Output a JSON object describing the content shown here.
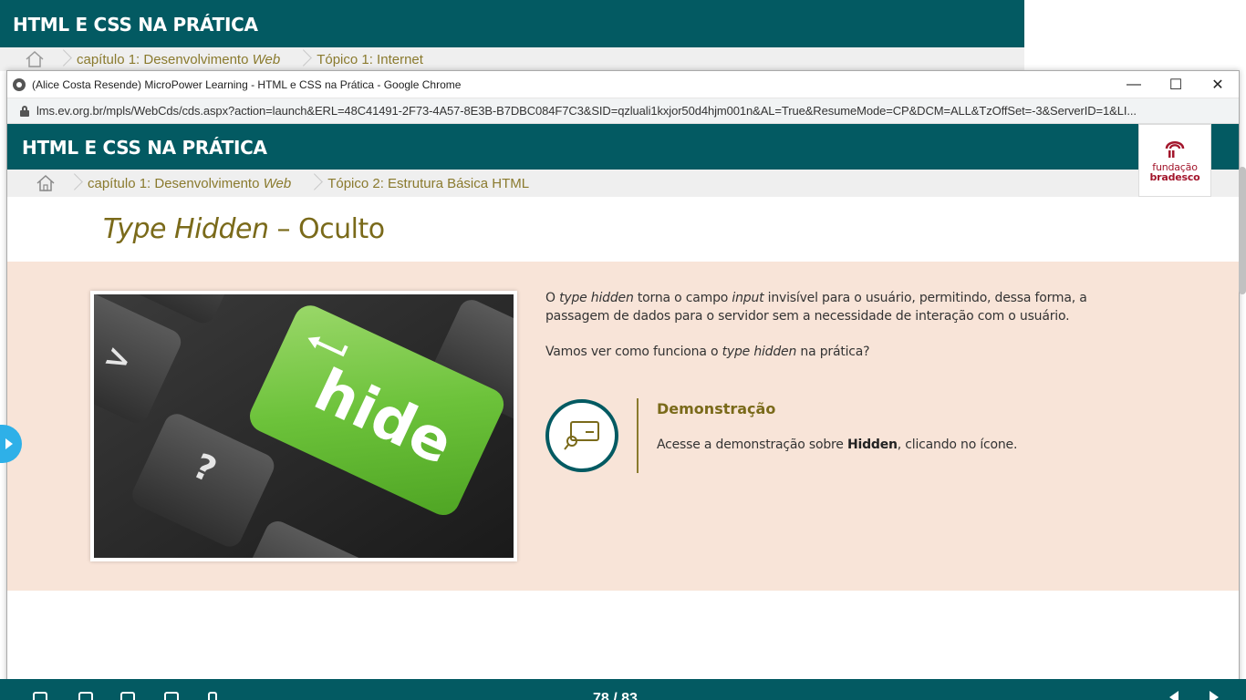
{
  "background_page": {
    "header_title": "HTML E CSS NA PRÁTICA",
    "breadcrumb": {
      "chapter_prefix": "capítulo 1: Desenvolvimento ",
      "chapter_emph": "Web",
      "topic": "Tópico 1: Internet"
    }
  },
  "browser": {
    "window_title": "(Alice Costa Resende) MicroPower Learning - HTML e CSS na Prática - Google Chrome",
    "url": "lms.ev.org.br/mpls/WebCds/cds.aspx?action=launch&ERL=48C41491-2F73-4A57-8E3B-B7DBC084F7C3&SID=qzluali1kxjor50d4hjm001n&AL=True&ResumeMode=CP&DCM=ALL&TzOffSet=-3&ServerID=1&LI...",
    "buttons": {
      "minimize": "—",
      "maximize": "☐",
      "close": "✕"
    }
  },
  "course": {
    "header_title": "HTML E CSS NA PRÁTICA",
    "logo": {
      "line1": "fundação",
      "line2": "bradesco"
    },
    "breadcrumb": {
      "chapter_prefix": "capítulo 1: Desenvolvimento ",
      "chapter_emph": "Web",
      "topic": "Tópico 2: Estrutura Básica HTML"
    },
    "page_title": {
      "emph": "Type Hidden",
      "rest": " – Oculto"
    },
    "image": {
      "key_label": "hide"
    },
    "paragraph1": {
      "p1": "O ",
      "e1": "type hidden",
      "p2": " torna o campo ",
      "e2": "input",
      "p3": " invisível para o usuário, permitindo, dessa forma, a passagem de dados para o servidor sem a necessidade de interação com o usuário."
    },
    "paragraph2": {
      "p1": "Vamos ver como funciona o ",
      "e1": "type hidden",
      "p2": " na prática?"
    },
    "demo": {
      "title": "Demonstração",
      "desc_prefix": "Acesse a demonstração sobre ",
      "desc_bold": "Hidden",
      "desc_suffix": ", clicando no ícone."
    },
    "footer": {
      "page_counter": "78 / 83"
    }
  },
  "colors": {
    "header_teal": "#035a62",
    "accent_olive": "#7a6a1a",
    "content_bg": "#f8e4d8",
    "key_green": "#6cc23a",
    "side_tab_blue": "#2eb0e8",
    "logo_red": "#a3162c"
  }
}
